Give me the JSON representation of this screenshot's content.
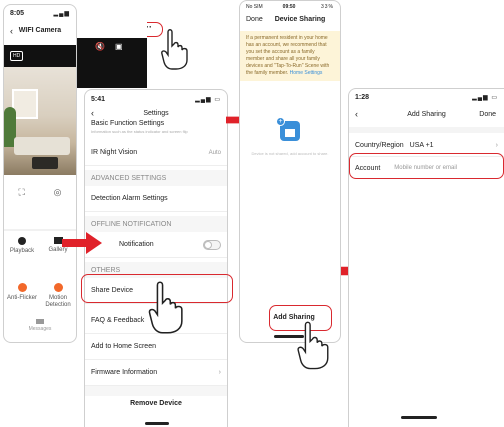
{
  "phone1": {
    "time": "8:05",
    "title": "WIFI Camera",
    "hd": "HD",
    "buttons": [
      "Playback",
      "Gallery"
    ],
    "buttons2": [
      "Anti-Flicker",
      "Motion Detection"
    ],
    "tab": "Messages"
  },
  "phone2": {
    "time": "5:41",
    "title": "Settings",
    "basic": "Basic Function Settings",
    "basic_sub": "Information such as the status indicator and screen flip",
    "ir": "IR Night Vision",
    "ir_value": "Auto",
    "advanced": "ADVANCED SETTINGS",
    "detection": "Detection Alarm Settings",
    "offline": "OFFLINE NOTIFICATION",
    "notification": "Notification",
    "others": "OTHERS",
    "share": "Share Device",
    "faq": "FAQ & Feedback",
    "home": "Add to Home Screen",
    "firmware": "Firmware Information",
    "remove": "Remove Device"
  },
  "phone3": {
    "carrier": "No SIM",
    "time": "09:50",
    "battery": "33%",
    "done": "Done",
    "title": "Device Sharing",
    "notice": "If a permanent resident in your home has an account, we recommend that you set the account as a family member and share all your family devices and \"Tap-To-Run\" Scene with the family member.",
    "notice_link": "Home Settings",
    "empty": "Device is not shared, add account to share.",
    "add": "Add Sharing"
  },
  "phone4": {
    "time": "1:28",
    "title": "Add Sharing",
    "done": "Done",
    "region_label": "Country/Region",
    "region_value": "USA +1",
    "account_label": "Account",
    "account_placeholder": "Mobile number or email"
  },
  "colors": {
    "highlight": "#d9292f",
    "arrow": "#e0222a",
    "orange": "#f2682a",
    "blue": "#3a8fd9"
  }
}
